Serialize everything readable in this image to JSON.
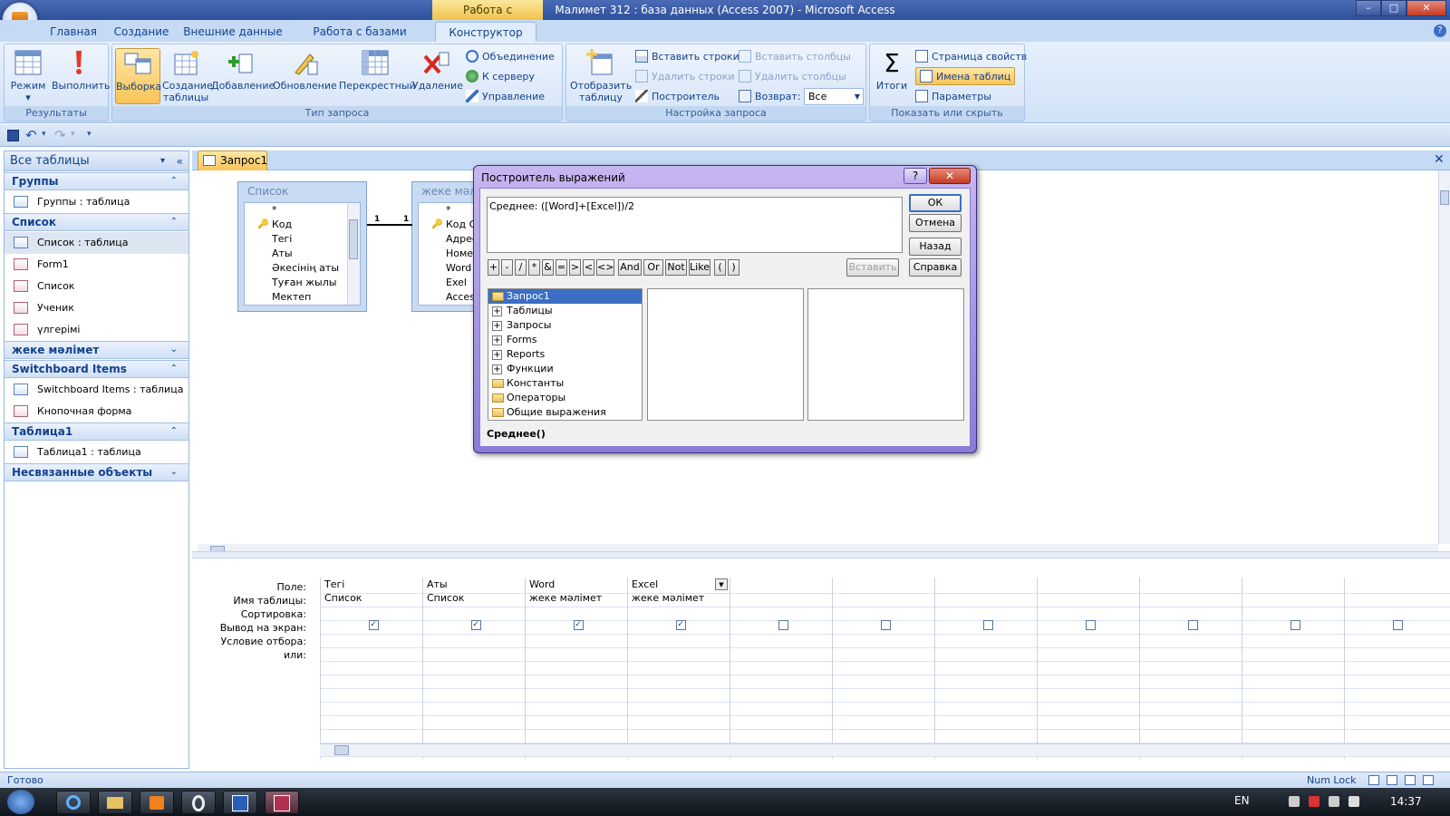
{
  "window": {
    "context_tab": "Работа с запросами",
    "title": "Малимет 312 : база данных (Access 2007) - Microsoft Access",
    "min": "–",
    "max": "□",
    "close": "✕"
  },
  "ribbon_tabs": [
    "Главная",
    "Создание",
    "Внешние данные",
    "Работа с базами данных",
    "Конструктор"
  ],
  "help": "?",
  "ribbon": {
    "results": {
      "label": "Результаты",
      "mode": "Режим",
      "run": "Выполнить"
    },
    "query_type": {
      "label": "Тип запроса",
      "select": "Выборка",
      "make_table_1": "Создание",
      "make_table_2": "таблицы",
      "append": "Добавление",
      "update": "Обновление",
      "crosstab": "Перекрестный",
      "delete": "Удаление",
      "union": "Объединение",
      "server": "К серверу",
      "manage": "Управление"
    },
    "setup": {
      "label": "Настройка запроса",
      "show_table_1": "Отобразить",
      "show_table_2": "таблицу",
      "insert_rows": "Вставить строки",
      "delete_rows": "Удалить строки",
      "builder": "Построитель",
      "insert_cols": "Вставить столбцы",
      "delete_cols": "Удалить столбцы",
      "return_label": "Возврат:",
      "return_value": "Все"
    },
    "show_hide": {
      "label": "Показать или скрыть",
      "totals": "Итоги",
      "sigma": "Σ",
      "property_sheet": "Страница свойств",
      "table_names": "Имена таблиц",
      "parameters": "Параметры"
    }
  },
  "nav": {
    "header": "Все таблицы",
    "groups": [
      {
        "name": "Группы",
        "chev": "⌃",
        "items": [
          {
            "label": "Группы : таблица",
            "kind": "table"
          }
        ]
      },
      {
        "name": "Список",
        "chev": "⌃",
        "items": [
          {
            "label": "Список : таблица",
            "kind": "table"
          },
          {
            "label": "Form1",
            "kind": "form"
          },
          {
            "label": "Список",
            "kind": "form"
          },
          {
            "label": "Ученик",
            "kind": "form"
          },
          {
            "label": "үлгерімі",
            "kind": "form"
          }
        ]
      },
      {
        "name": "жеке мәлімет",
        "chev": "⌄",
        "items": []
      },
      {
        "name": "Switchboard Items",
        "chev": "⌃",
        "items": [
          {
            "label": "Switchboard Items : таблица",
            "kind": "table"
          },
          {
            "label": "Кнопочная форма",
            "kind": "form"
          }
        ]
      },
      {
        "name": "Таблица1",
        "chev": "⌃",
        "items": [
          {
            "label": "Таблица1 : таблица",
            "kind": "table"
          }
        ]
      },
      {
        "name": "Несвязанные объекты",
        "chev": "⌄",
        "items": []
      }
    ]
  },
  "doc_tab": "Запрос1",
  "tables": [
    {
      "title": "Список",
      "fields": [
        {
          "name": "*",
          "key": false
        },
        {
          "name": "Код",
          "key": true
        },
        {
          "name": "Тегі",
          "key": false
        },
        {
          "name": "Аты",
          "key": false
        },
        {
          "name": "Әкесінің аты",
          "key": false
        },
        {
          "name": "Туған жылы",
          "key": false
        },
        {
          "name": "Мектеп",
          "key": false
        }
      ]
    },
    {
      "title": "жеке мәлі",
      "fields": [
        {
          "name": "*",
          "key": false
        },
        {
          "name": "Код С",
          "key": true
        },
        {
          "name": "Адрес",
          "key": false
        },
        {
          "name": "Номе",
          "key": false
        },
        {
          "name": "Word",
          "key": false
        },
        {
          "name": "Exel",
          "key": false
        },
        {
          "name": "Acces",
          "key": false
        }
      ]
    }
  ],
  "relation": {
    "left": "1",
    "right": "1"
  },
  "grid": {
    "row_labels": [
      "Поле:",
      "Имя таблицы:",
      "Сортировка:",
      "Вывод на экран:",
      "Условие отбора:",
      "или:"
    ],
    "columns": [
      {
        "field": "Тегі",
        "table": "Список",
        "show": true
      },
      {
        "field": "Аты",
        "table": "Список",
        "show": true
      },
      {
        "field": "Word",
        "table": "жеке мәлімет",
        "show": true
      },
      {
        "field": "Excel",
        "table": "жеке мәлімет",
        "show": true
      },
      {
        "field": "",
        "table": "",
        "show": false
      },
      {
        "field": "",
        "table": "",
        "show": false
      },
      {
        "field": "",
        "table": "",
        "show": false
      },
      {
        "field": "",
        "table": "",
        "show": false
      },
      {
        "field": "",
        "table": "",
        "show": false
      },
      {
        "field": "",
        "table": "",
        "show": false
      },
      {
        "field": "",
        "table": "",
        "show": false
      }
    ]
  },
  "dialog": {
    "title": "Построитель выражений",
    "help": "?",
    "close": "✕",
    "expression": "Среднее: ([Word]+[Excel])/2",
    "ok": "ОК",
    "cancel": "Отмена",
    "back": "Назад",
    "paste": "Вставить",
    "help_btn": "Справка",
    "operators": [
      "+",
      "-",
      "/",
      "*",
      "&",
      "=",
      ">",
      "<",
      "<>",
      "And",
      "Or",
      "Not",
      "Like",
      "(",
      ")"
    ],
    "tree": [
      {
        "label": "Запрос1",
        "type": "folder-open",
        "selected": true
      },
      {
        "label": "Таблицы",
        "type": "plus"
      },
      {
        "label": "Запросы",
        "type": "plus"
      },
      {
        "label": "Forms",
        "type": "plus"
      },
      {
        "label": "Reports",
        "type": "plus"
      },
      {
        "label": "Функции",
        "type": "plus"
      },
      {
        "label": "Константы",
        "type": "folder"
      },
      {
        "label": "Операторы",
        "type": "folder"
      },
      {
        "label": "Общие выражения",
        "type": "folder"
      }
    ],
    "footer": "Среднее()"
  },
  "status": {
    "left": "Готово",
    "numlock": "Num Lock"
  },
  "taskbar": {
    "lang": "EN",
    "time": "14:37"
  }
}
